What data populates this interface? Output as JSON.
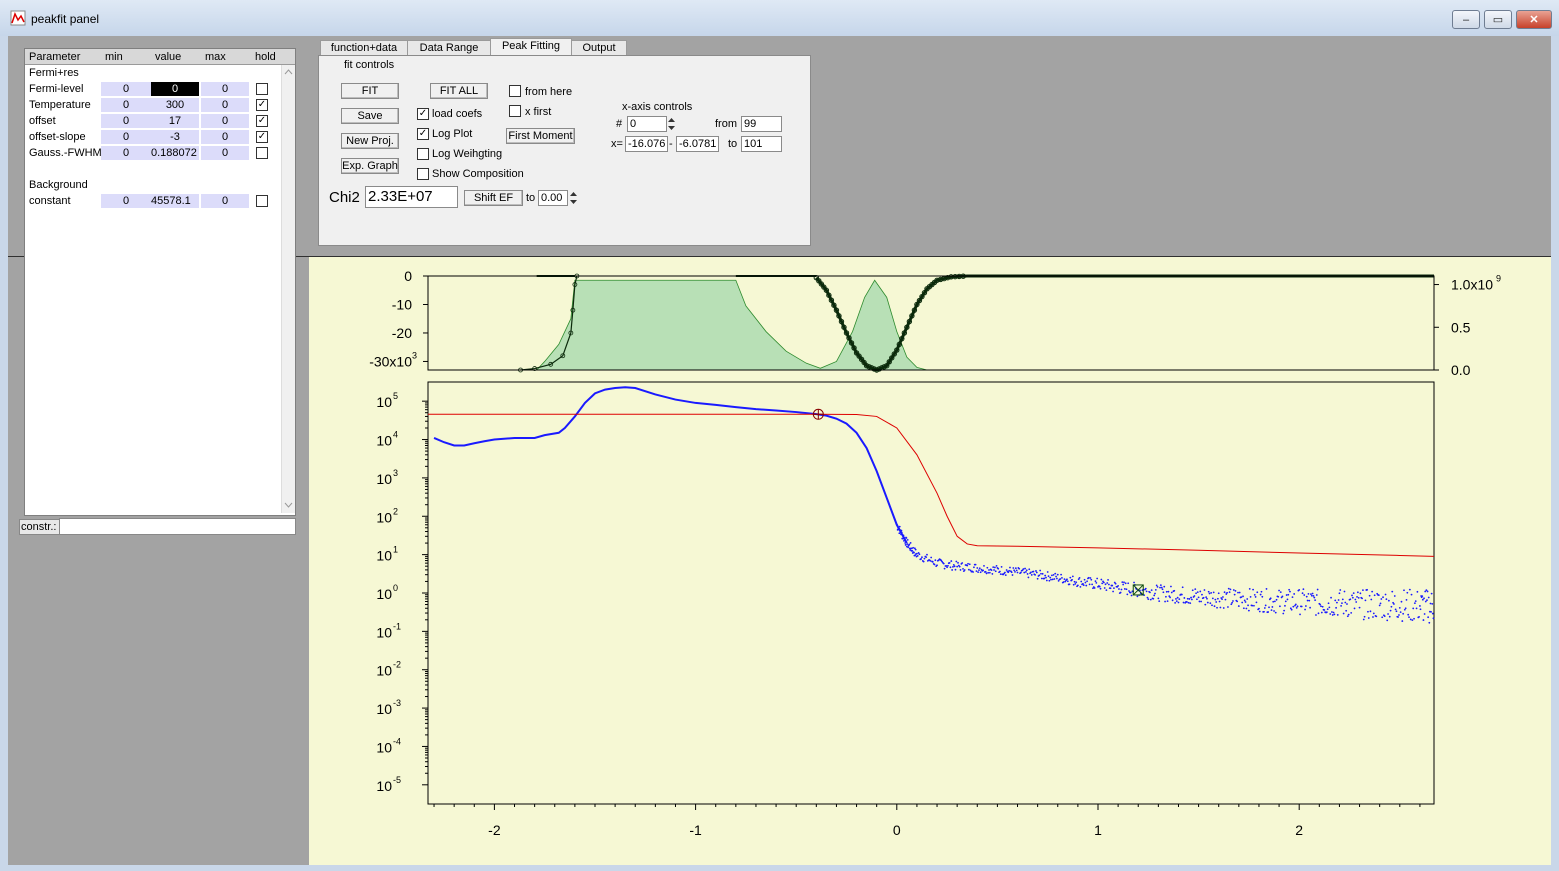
{
  "window": {
    "title": "peakfit panel",
    "min_glyph": "–",
    "max_glyph": "▭",
    "close_glyph": "✕"
  },
  "params": {
    "headers": [
      "Parameter",
      "min",
      "value",
      "max",
      "hold"
    ],
    "rows": [
      {
        "name": "Fermi+res",
        "min": "",
        "value": "",
        "max": "",
        "hold": null,
        "section": true
      },
      {
        "name": "Fermi-level",
        "min": "0",
        "value": "0",
        "max": "0",
        "hold": false,
        "selected": true
      },
      {
        "name": "Temperature",
        "min": "0",
        "value": "300",
        "max": "0",
        "hold": true
      },
      {
        "name": "offset",
        "min": "0",
        "value": "17",
        "max": "0",
        "hold": true
      },
      {
        "name": "offset-slope",
        "min": "0",
        "value": "-3",
        "max": "0",
        "hold": true
      },
      {
        "name": "Gauss.-FWHM",
        "min": "0",
        "value": "0.188072",
        "max": "0",
        "hold": false
      },
      {
        "name": "",
        "min": "",
        "value": "",
        "max": "",
        "hold": null,
        "section": true
      },
      {
        "name": "Background",
        "min": "",
        "value": "",
        "max": "",
        "hold": null,
        "section": true
      },
      {
        "name": "constant",
        "min": "0",
        "value": "45578.1",
        "max": "0",
        "hold": false
      }
    ],
    "constr_label": "constr.:",
    "constr_value": ""
  },
  "tabs": [
    "function+data",
    "Data Range",
    "Peak Fitting",
    "Output"
  ],
  "peak_fitting": {
    "group_label": "fit controls",
    "fit": "FIT",
    "save": "Save",
    "new_proj": "New Proj.",
    "exp_graph": "Exp. Graph",
    "fit_all": "FIT ALL",
    "load_coefs": {
      "label": "load coefs",
      "checked": true
    },
    "log_plot": {
      "label": "Log Plot",
      "checked": true
    },
    "log_weighting": {
      "label": "Log Weihgting",
      "checked": false
    },
    "show_composition": {
      "label": "Show Composition",
      "checked": false
    },
    "from_here": {
      "label": "from here",
      "checked": false
    },
    "x_first": {
      "label": "x first",
      "checked": false
    },
    "first_moment": "First Moment",
    "xaxis_label": "x-axis controls",
    "hash_label": "#",
    "hash_value": "0",
    "from_label": "from",
    "from_value": "99",
    "x_label": "x=",
    "x_value1": "-16.076",
    "x_dash": "-",
    "x_value2": "-6.0781",
    "to_label": "to",
    "to_value": "101",
    "chi2_label": "Chi2",
    "chi2_value": "2.33E+07",
    "shift_ef": "Shift EF",
    "shift_to_label": "to",
    "shift_to_value": "0.00"
  },
  "colors": {
    "data": "#1a1aff",
    "fit": "#dd0000",
    "residual": "#0b2a0b",
    "fill": "#b8e0b6",
    "plot_bg": "#f6f8d4"
  },
  "chart_data": [
    {
      "type": "area",
      "name": "residual",
      "y_left_ticks": [
        "0",
        "-10",
        "-20",
        "-30x10"
      ],
      "y_left_ticks_sup": [
        "",
        "",
        "",
        "3"
      ],
      "y_left_range": [
        -33000,
        0
      ],
      "y_right_ticks": [
        "1.0x10",
        "0.5",
        "0.0"
      ],
      "y_right_ticks_sup": [
        "9",
        "",
        ""
      ],
      "y_right_range": [
        0,
        1100000000.0
      ],
      "xlim": [
        -2.33,
        2.67
      ],
      "residual_points": [
        [
          -1.87,
          -33000
        ],
        [
          -1.8,
          -32500
        ],
        [
          -1.72,
          -31000
        ],
        [
          -1.66,
          -28000
        ],
        [
          -1.62,
          -20000
        ],
        [
          -1.61,
          -12000
        ],
        [
          -1.6,
          -3000
        ],
        [
          -1.59,
          0
        ]
      ],
      "residual_dip": [
        [
          -0.4,
          -600
        ],
        [
          -0.35,
          -5000
        ],
        [
          -0.3,
          -12000
        ],
        [
          -0.25,
          -20000
        ],
        [
          -0.2,
          -27000
        ],
        [
          -0.15,
          -31500
        ],
        [
          -0.1,
          -33000
        ],
        [
          -0.05,
          -31500
        ],
        [
          0.0,
          -26000
        ],
        [
          0.05,
          -18000
        ],
        [
          0.1,
          -10000
        ],
        [
          0.15,
          -4500
        ],
        [
          0.2,
          -1500
        ],
        [
          0.27,
          -300
        ],
        [
          0.35,
          0
        ],
        [
          2.67,
          0
        ]
      ],
      "composition_fill": [
        [
          -1.9,
          0
        ],
        [
          -1.79,
          0
        ],
        [
          -1.75,
          100000000.0
        ],
        [
          -1.68,
          300000000.0
        ],
        [
          -1.62,
          600000000.0
        ],
        [
          -1.6,
          1050000000.0
        ],
        [
          -1.58,
          1050000000.0
        ],
        [
          -0.8,
          1050000000.0
        ],
        [
          -0.75,
          750000000.0
        ],
        [
          -0.65,
          450000000.0
        ],
        [
          -0.55,
          220000000.0
        ],
        [
          -0.45,
          80000000.0
        ],
        [
          -0.38,
          20000000.0
        ],
        [
          -0.3,
          100000000.0
        ],
        [
          -0.22,
          450000000.0
        ],
        [
          -0.16,
          850000000.0
        ],
        [
          -0.11,
          1050000000.0
        ],
        [
          -0.05,
          850000000.0
        ],
        [
          0.0,
          450000000.0
        ],
        [
          0.05,
          150000000.0
        ],
        [
          0.1,
          30000000.0
        ],
        [
          0.15,
          0
        ]
      ]
    },
    {
      "type": "scatter",
      "name": "spectrum",
      "xlabel": "",
      "ylabel": "",
      "x_ticks": [
        "-2",
        "-1",
        "0",
        "1",
        "2"
      ],
      "y_ticks": [
        5,
        4,
        3,
        2,
        1,
        0,
        -1,
        -2,
        -3,
        -4,
        -5
      ],
      "y_scale": "log",
      "xlim": [
        -2.33,
        2.67
      ],
      "ylim": [
        3.16e-06,
        316000.0
      ],
      "data_curve": [
        [
          -2.3,
          11000
        ],
        [
          -2.25,
          8500
        ],
        [
          -2.2,
          7000
        ],
        [
          -2.15,
          7000
        ],
        [
          -2.1,
          8000
        ],
        [
          -2.05,
          9000
        ],
        [
          -2.0,
          10000
        ],
        [
          -1.9,
          11000
        ],
        [
          -1.8,
          11000
        ],
        [
          -1.75,
          13000
        ],
        [
          -1.68,
          15000
        ],
        [
          -1.65,
          20000
        ],
        [
          -1.6,
          40000
        ],
        [
          -1.55,
          90000
        ],
        [
          -1.5,
          160000
        ],
        [
          -1.45,
          200000
        ],
        [
          -1.4,
          220000
        ],
        [
          -1.35,
          230000
        ],
        [
          -1.3,
          220000
        ],
        [
          -1.2,
          150000
        ],
        [
          -1.1,
          110000
        ],
        [
          -1.0,
          90000
        ],
        [
          -0.9,
          80000
        ],
        [
          -0.8,
          70000
        ],
        [
          -0.7,
          62000
        ],
        [
          -0.6,
          57000
        ],
        [
          -0.5,
          52000
        ],
        [
          -0.4,
          46000
        ],
        [
          -0.35,
          42000
        ],
        [
          -0.3,
          35000
        ],
        [
          -0.25,
          26000
        ],
        [
          -0.2,
          15000
        ],
        [
          -0.15,
          6000
        ],
        [
          -0.1,
          1500
        ],
        [
          -0.05,
          300
        ],
        [
          0.0,
          60
        ],
        [
          0.05,
          20
        ],
        [
          0.1,
          10
        ],
        [
          0.2,
          6
        ],
        [
          0.3,
          5
        ],
        [
          0.4,
          4.5
        ],
        [
          0.5,
          4
        ],
        [
          0.6,
          3.5
        ],
        [
          0.7,
          3
        ],
        [
          0.8,
          2.5
        ],
        [
          0.9,
          2
        ],
        [
          1.0,
          1.7
        ],
        [
          1.1,
          1.4
        ],
        [
          1.2,
          1.2
        ],
        [
          1.3,
          1.0
        ],
        [
          1.4,
          0.9
        ],
        [
          1.5,
          0.8
        ],
        [
          1.6,
          0.75
        ],
        [
          1.7,
          0.7
        ],
        [
          1.8,
          0.65
        ],
        [
          1.9,
          0.6
        ],
        [
          2.0,
          0.6
        ],
        [
          2.1,
          0.55
        ],
        [
          2.2,
          0.55
        ],
        [
          2.3,
          0.5
        ],
        [
          2.4,
          0.5
        ],
        [
          2.5,
          0.5
        ],
        [
          2.6,
          0.45
        ],
        [
          2.67,
          0.45
        ]
      ],
      "fit_curve": [
        [
          -2.33,
          45578
        ],
        [
          -0.4,
          45578
        ],
        [
          -0.2,
          45000
        ],
        [
          -0.1,
          40000
        ],
        [
          0.0,
          20000
        ],
        [
          0.1,
          4000
        ],
        [
          0.2,
          400
        ],
        [
          0.25,
          100
        ],
        [
          0.3,
          30
        ],
        [
          0.35,
          19
        ],
        [
          0.4,
          17
        ],
        [
          0.6,
          16.5
        ],
        [
          1.0,
          15
        ],
        [
          1.5,
          13
        ],
        [
          2.0,
          11
        ],
        [
          2.5,
          9.5
        ],
        [
          2.67,
          9
        ]
      ],
      "marker_circle": [
        -0.39,
        45578
      ],
      "marker_square": [
        1.2,
        1.2
      ]
    }
  ]
}
